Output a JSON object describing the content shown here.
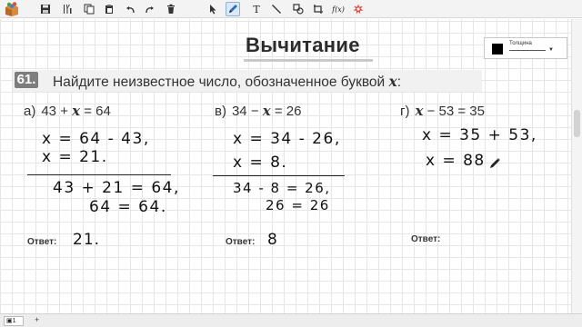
{
  "toolbar": {
    "text_tool": "T",
    "formula_tool": "f(x)",
    "icons": [
      "logo-icon",
      "save-icon",
      "tools-icon",
      "copy-icon",
      "paste-icon",
      "undo-icon",
      "redo-icon",
      "delete-icon",
      "pointer-icon",
      "pen-icon",
      "text-icon",
      "line-icon",
      "shapes-icon",
      "crop-icon",
      "formula-icon",
      "burst-icon"
    ]
  },
  "title": "Вычитание",
  "thickness": {
    "label": "Толщина"
  },
  "task": {
    "number": "61.",
    "text": "Найдите неизвестное число, обозначенное буквой",
    "variable": "x",
    "colon": ":"
  },
  "problems": [
    {
      "label": "а)",
      "equation_pre": "43 + ",
      "equation_x": "x",
      "equation_post": " = 64",
      "solution": [
        "x = 64 - 43,",
        "x = 21."
      ],
      "check": [
        "43 + 21 = 64,",
        "64 = 64."
      ],
      "answer_label": "Ответ:",
      "answer": "21."
    },
    {
      "label": "в)",
      "equation_pre": "34 − ",
      "equation_x": "x",
      "equation_post": " = 26",
      "solution": [
        "x = 34 - 26,",
        "x = 8."
      ],
      "check": [
        "34 - 8 = 26,",
        "26 = 26"
      ],
      "answer_label": "Ответ:",
      "answer": "8"
    },
    {
      "label": "г)",
      "equation_pre": "",
      "equation_x": "x",
      "equation_post": " − 53 = 35",
      "solution": [
        "x = 35 + 53,",
        "x = 88"
      ],
      "answer_label": "Ответ:"
    }
  ],
  "statusbar": {
    "page": "1",
    "add": "+"
  }
}
